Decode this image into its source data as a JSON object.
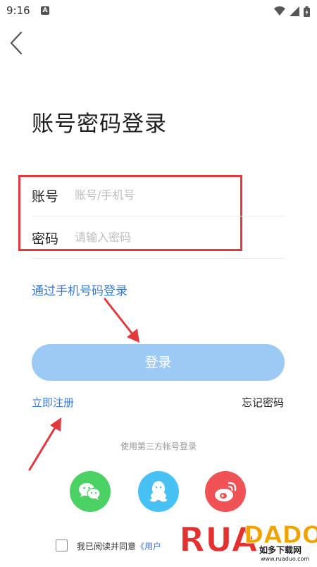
{
  "status_bar": {
    "time": "9:16",
    "notification_letter": "A"
  },
  "header": {
    "back_icon": "chevron-left-icon"
  },
  "title": "账号密码登录",
  "form": {
    "account_label": "账号",
    "account_placeholder": "账号/手机号",
    "account_value": "",
    "password_label": "密码",
    "password_placeholder": "请输入密码",
    "password_value": ""
  },
  "links": {
    "phone_login": "通过手机号码登录",
    "register": "立即注册",
    "forgot_password": "忘记密码"
  },
  "login_button": "登录",
  "third_party": {
    "label": "使用第三方帐号登录",
    "providers": [
      {
        "icon": "wechat-icon",
        "color": "#4cd264"
      },
      {
        "icon": "qq-icon",
        "color": "#48c2f5"
      },
      {
        "icon": "weibo-icon",
        "color": "#f05256"
      }
    ]
  },
  "agreement": {
    "text": "我已阅读并同意",
    "link": "《用户"
  },
  "watermark": {
    "brand": "RUADADO",
    "cn": "如多下载网",
    "url": "www.ruaduo.com"
  },
  "colors": {
    "accent": "#3a7bd5",
    "button": "#9ccaf4",
    "highlight": "#e4393c"
  }
}
